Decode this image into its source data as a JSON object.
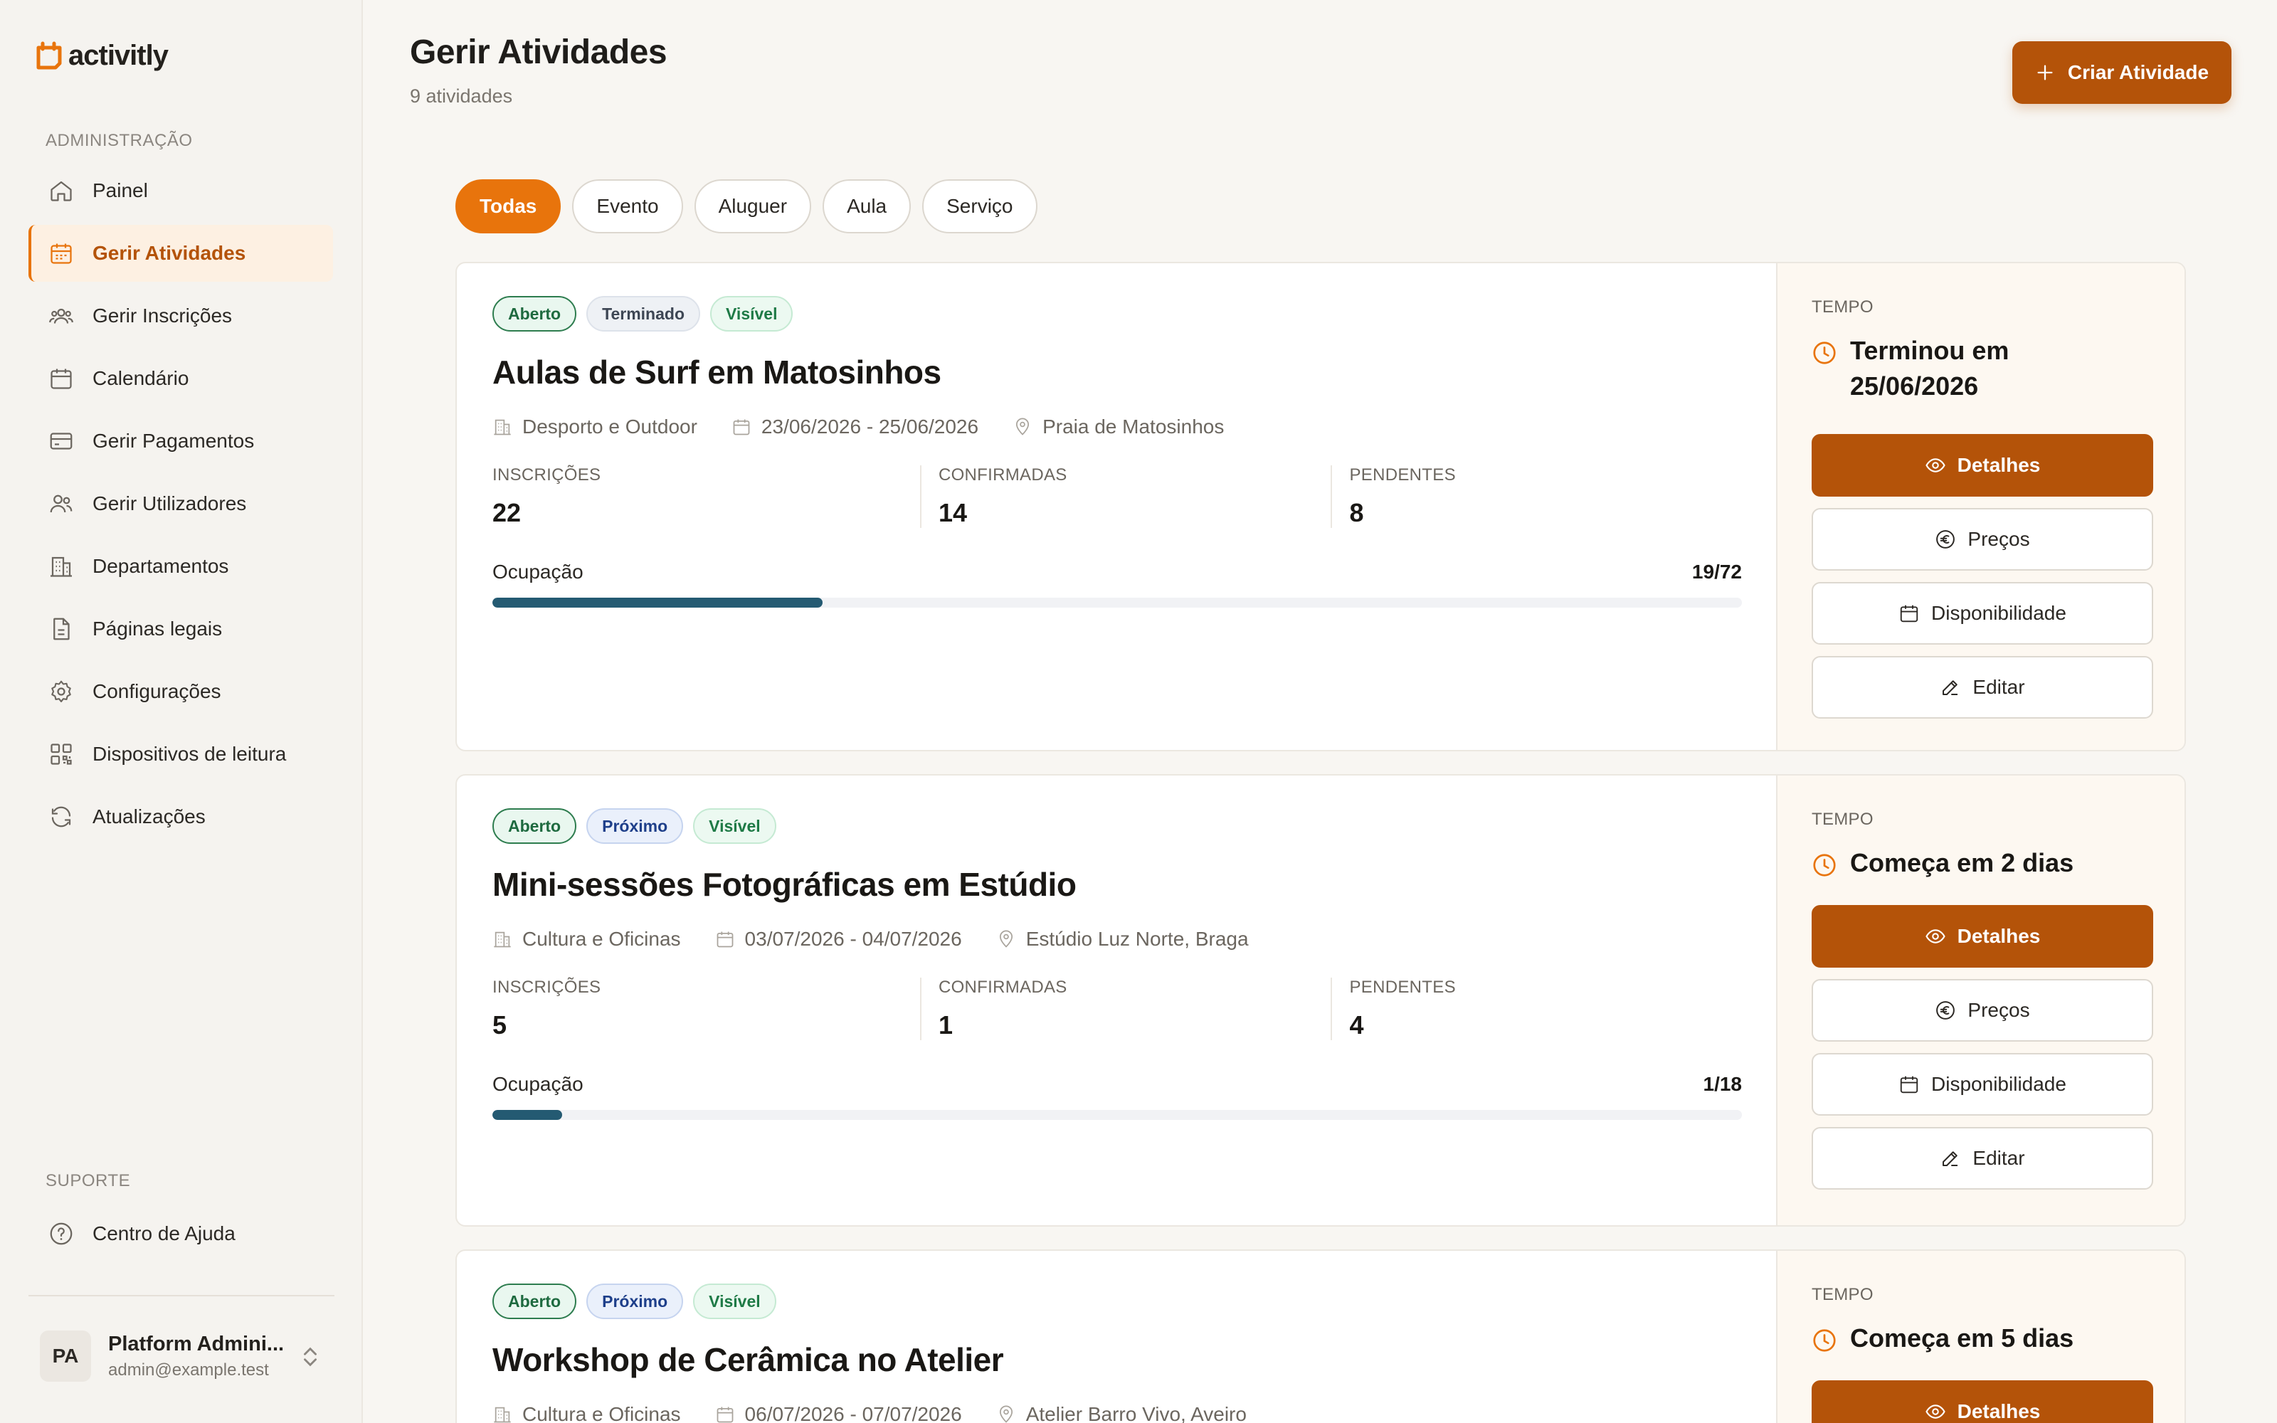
{
  "app": {
    "name": "activitly"
  },
  "sidebar": {
    "section_admin": "ADMINISTRAÇÃO",
    "items": [
      {
        "label": "Painel",
        "icon": "home-icon"
      },
      {
        "label": "Gerir Atividades",
        "icon": "calendar-list-icon",
        "active": true
      },
      {
        "label": "Gerir Inscrições",
        "icon": "users-group-icon"
      },
      {
        "label": "Calendário",
        "icon": "calendar-icon"
      },
      {
        "label": "Gerir Pagamentos",
        "icon": "credit-card-icon"
      },
      {
        "label": "Gerir Utilizadores",
        "icon": "users-icon"
      },
      {
        "label": "Departamentos",
        "icon": "building-icon"
      },
      {
        "label": "Páginas legais",
        "icon": "document-icon"
      },
      {
        "label": "Configurações",
        "icon": "gear-icon"
      },
      {
        "label": "Dispositivos de leitura",
        "icon": "qr-code-icon"
      },
      {
        "label": "Atualizações",
        "icon": "refresh-icon"
      }
    ],
    "section_support": "SUPORTE",
    "help": {
      "label": "Centro de Ajuda",
      "icon": "help-circle-icon"
    },
    "user": {
      "initials": "PA",
      "name": "Platform Admini...",
      "email": "admin@example.test"
    }
  },
  "header": {
    "title": "Gerir Atividades",
    "subtitle": "9 atividades",
    "create_label": "Criar Atividade"
  },
  "filters": [
    "Todas",
    "Evento",
    "Aluguer",
    "Aula",
    "Serviço"
  ],
  "active_filter": "Todas",
  "labels": {
    "inscricoes": "INSCRIÇÕES",
    "confirmadas": "CONFIRMADAS",
    "pendentes": "PENDENTES",
    "ocupacao": "Ocupação",
    "tempo": "TEMPO",
    "detalhes": "Detalhes",
    "precos": "Preços",
    "disponibilidade": "Disponibilidade",
    "editar": "Editar"
  },
  "activities": [
    {
      "badges": [
        {
          "text": "Aberto",
          "kind": "open"
        },
        {
          "text": "Terminado",
          "kind": "done"
        },
        {
          "text": "Visível",
          "kind": "vis"
        }
      ],
      "title": "Aulas de Surf em Matosinhos",
      "department": "Desporto e Outdoor",
      "dates": "23/06/2026 - 25/06/2026",
      "location": "Praia de Matosinhos",
      "inscricoes": "22",
      "confirmadas": "14",
      "pendentes": "8",
      "ocupacao": "19/72",
      "occupancy_fraction": 0.264,
      "tempo_line1": "Terminou em",
      "tempo_line2": "25/06/2026"
    },
    {
      "badges": [
        {
          "text": "Aberto",
          "kind": "open"
        },
        {
          "text": "Próximo",
          "kind": "next"
        },
        {
          "text": "Visível",
          "kind": "vis"
        }
      ],
      "title": "Mini-sessões Fotográficas em Estúdio",
      "department": "Cultura e Oficinas",
      "dates": "03/07/2026 - 04/07/2026",
      "location": "Estúdio Luz Norte, Braga",
      "inscricoes": "5",
      "confirmadas": "1",
      "pendentes": "4",
      "ocupacao": "1/18",
      "occupancy_fraction": 0.056,
      "tempo_line1": "Começa em 2 dias",
      "tempo_line2": ""
    },
    {
      "badges": [
        {
          "text": "Aberto",
          "kind": "open"
        },
        {
          "text": "Próximo",
          "kind": "next"
        },
        {
          "text": "Visível",
          "kind": "vis"
        }
      ],
      "title": "Workshop de Cerâmica no Atelier",
      "department": "Cultura e Oficinas",
      "dates": "06/07/2026 - 07/07/2026",
      "location": "Atelier Barro Vivo, Aveiro",
      "inscricoes": "",
      "confirmadas": "",
      "pendentes": "",
      "ocupacao": "",
      "occupancy_fraction": 0,
      "tempo_line1": "Começa em 5 dias",
      "tempo_line2": ""
    }
  ],
  "colors": {
    "accent": "#e8740c",
    "primary_button": "#b45309",
    "progress": "#245a72"
  }
}
